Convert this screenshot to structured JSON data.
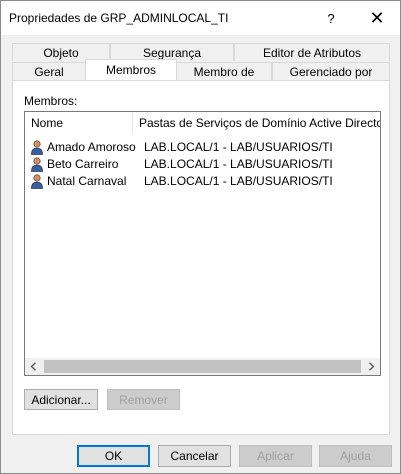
{
  "window": {
    "title": "Propriedades de GRP_ADMINLOCAL_TI",
    "help_glyph": "?",
    "close_glyph": "✕"
  },
  "tabs_row1": [
    {
      "label": "Objeto"
    },
    {
      "label": "Segurança"
    },
    {
      "label": "Editor de Atributos"
    }
  ],
  "tabs_row2": [
    {
      "label": "Geral"
    },
    {
      "label": "Membros",
      "active": true
    },
    {
      "label": "Membro de"
    },
    {
      "label": "Gerenciado por"
    }
  ],
  "members": {
    "label": "Membros:",
    "columns": [
      "Nome",
      "Pastas de Serviços de Domínio Active Directory"
    ],
    "rows": [
      {
        "name": "Amado Amoroso",
        "folder": "LAB.LOCAL/1 - LAB/USUARIOS/TI",
        "icon": "user-icon"
      },
      {
        "name": "Beto Carreiro",
        "folder": "LAB.LOCAL/1 - LAB/USUARIOS/TI",
        "icon": "user-icon"
      },
      {
        "name": "Natal Carnaval",
        "folder": "LAB.LOCAL/1 - LAB/USUARIOS/TI",
        "icon": "user-icon"
      }
    ]
  },
  "actions": {
    "add": "Adicionar...",
    "remove": "Remover"
  },
  "footer": {
    "ok": "OK",
    "cancel": "Cancelar",
    "apply": "Aplicar",
    "help": "Ajuda"
  },
  "colors": {
    "accent": "#0078d7",
    "window_bg": "#f0f0f0",
    "disabled_text": "#a0a0a0"
  }
}
